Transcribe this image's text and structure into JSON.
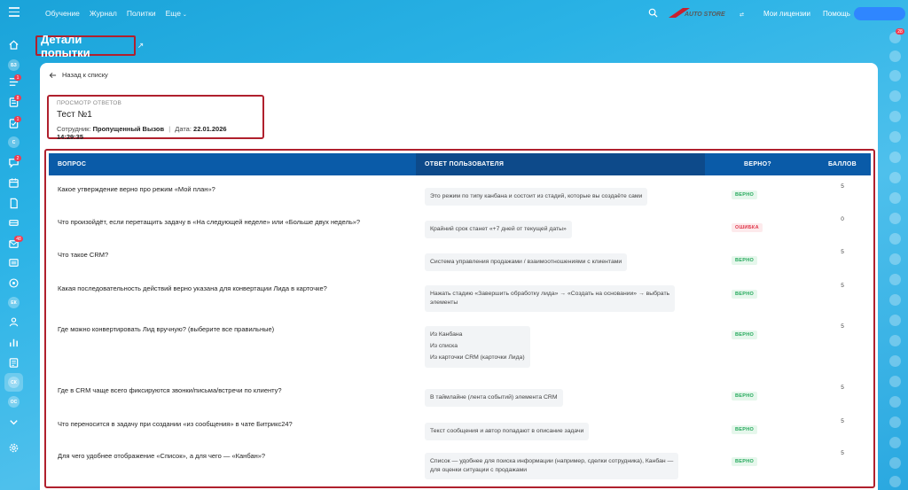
{
  "topbar": {
    "nav": [
      "Обучение",
      "Журнал",
      "Политки",
      "Еще"
    ],
    "logo_text": "AUTO STORE",
    "licenses": "Мои лицензии",
    "help": "Помощь",
    "accent": "#2f86ff"
  },
  "sidebar": {
    "circles": [
      "БЗ",
      "С",
      "ЕК",
      "СК",
      "ОС"
    ],
    "badges": [
      "1",
      "8",
      "1",
      "2",
      "48"
    ]
  },
  "right_rail": {
    "badge": "28"
  },
  "page": {
    "title": "Детали попытки",
    "back": "Назад к списку"
  },
  "info": {
    "caption": "Просмотр ответов",
    "test_name": "Тест №1",
    "employee_label": "Сотрудник:",
    "employee": "Пропущенный Вызов",
    "date_label": "Дата:",
    "date": "22.01.2026 14:29:35"
  },
  "table": {
    "headers": [
      "ВОПРОС",
      "ОТВЕТ ПОЛЬЗОВАТЕЛЯ",
      "ВЕРНО?",
      "БАЛЛОВ"
    ],
    "rows": [
      {
        "q": "Какое утверждение верно про режим «Мой план»?",
        "a": [
          "Это режим по типу канбана и состоит из стадий, которые вы создаёте сами"
        ],
        "v": "ВЕРНО",
        "ok": true,
        "s": "5"
      },
      {
        "q": "Что произойдёт, если перетащить задачу в «На следующей неделе» или «Больше двух недель»?",
        "a": [
          "Крайний срок станет «+7 дней от текущей даты»"
        ],
        "v": "ОШИБКА",
        "ok": false,
        "s": "0"
      },
      {
        "q": "Что такое CRM?",
        "a": [
          "Система управления продажами / взаимоотношениями с клиентами"
        ],
        "v": "ВЕРНО",
        "ok": true,
        "s": "5"
      },
      {
        "q": "Какая последовательность действий верно указана для конвертации Лида в карточке?",
        "a": [
          "Нажать стадию «Завершить обработку лида» → «Создать на основании» → выбрать",
          "элементы"
        ],
        "v": "ВЕРНО",
        "ok": true,
        "s": "5"
      },
      {
        "q": "Где можно конвертировать Лид вручную? (выберите все правильные)",
        "a": [
          "Из Канбана",
          "Из списка",
          "Из карточки CRM (карточки Лида)"
        ],
        "list": true,
        "v": "ВЕРНО",
        "ok": true,
        "s": "5"
      },
      {
        "q": "Где в CRM чаще всего фиксируются звонки/письма/встречи по клиенту?",
        "a": [
          "В таймлайне (лента событий) элемента CRM"
        ],
        "v": "ВЕРНО",
        "ok": true,
        "s": "5"
      },
      {
        "q": "Что переносится в задачу при создании «из сообщения» в чате Битрикс24?",
        "a": [
          "Текст сообщения и автор попадают в описание задачи"
        ],
        "v": "ВЕРНО",
        "ok": true,
        "s": "5"
      },
      {
        "q": "Для чего удобнее отображение «Список», а для чего — «Канбан»?",
        "a": [
          "Список — удобнее для поиска информации (например, сделки сотрудника), Канбан —",
          "для оценки ситуации с продажами"
        ],
        "v": "ВЕРНО",
        "ok": true,
        "s": "5"
      }
    ]
  }
}
